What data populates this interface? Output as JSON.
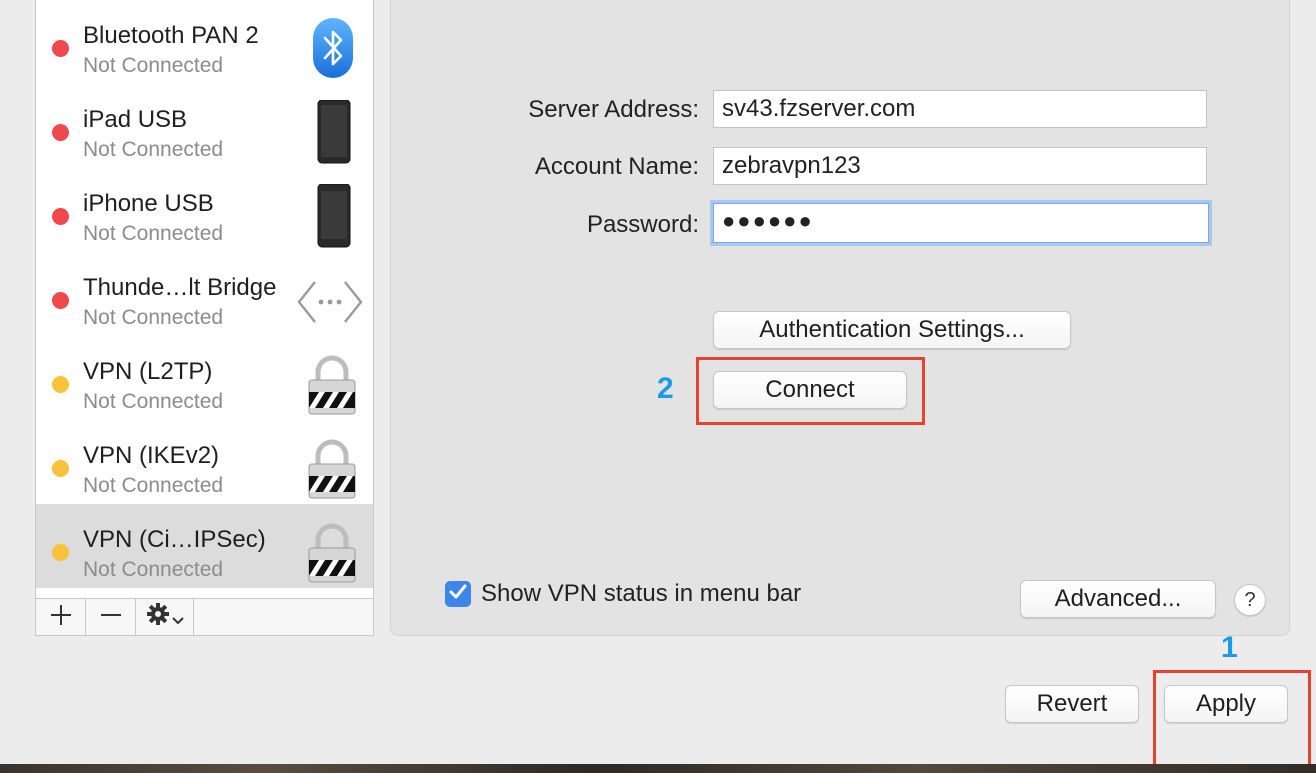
{
  "services": [
    {
      "name": "Bluetooth PAN 2",
      "status": "Not Connected",
      "dot_color": "#f0484c",
      "icon": "bluetooth-icon"
    },
    {
      "name": "iPad USB",
      "status": "Not Connected",
      "dot_color": "#f0484c",
      "icon": "ipad-icon"
    },
    {
      "name": "iPhone USB",
      "status": "Not Connected",
      "dot_color": "#f0484c",
      "icon": "iphone-icon"
    },
    {
      "name": "Thunde…lt Bridge",
      "status": "Not Connected",
      "dot_color": "#f0484c",
      "icon": "thunderbolt-bridge-icon"
    },
    {
      "name": "VPN (L2TP)",
      "status": "Not Connected",
      "dot_color": "#f8c33a",
      "icon": "lock-icon"
    },
    {
      "name": "VPN (IKEv2)",
      "status": "Not Connected",
      "dot_color": "#f8c33a",
      "icon": "lock-icon"
    },
    {
      "name": "VPN (Ci…IPSec)",
      "status": "Not Connected",
      "dot_color": "#f8c33a",
      "icon": "lock-icon",
      "selected": true
    }
  ],
  "toolbar": {
    "add_icon": "plus-icon",
    "remove_icon": "minus-icon",
    "action_icon": "gear-icon"
  },
  "form": {
    "server_label": "Server Address:",
    "server_value": "sv43.fzserver.com",
    "account_label": "Account Name:",
    "account_value": "zebravpn123",
    "password_label": "Password:",
    "password_value": "●●●●●●"
  },
  "buttons": {
    "auth_settings": "Authentication Settings...",
    "connect": "Connect",
    "advanced": "Advanced...",
    "help": "?",
    "revert": "Revert",
    "apply": "Apply"
  },
  "options": {
    "show_vpn_status": "Show VPN status in menu bar",
    "show_vpn_status_checked": true
  },
  "annotations": {
    "step_connect": "2",
    "step_apply": "1",
    "highlight_color": "#e8412f",
    "number_color": "#1a9be6"
  }
}
